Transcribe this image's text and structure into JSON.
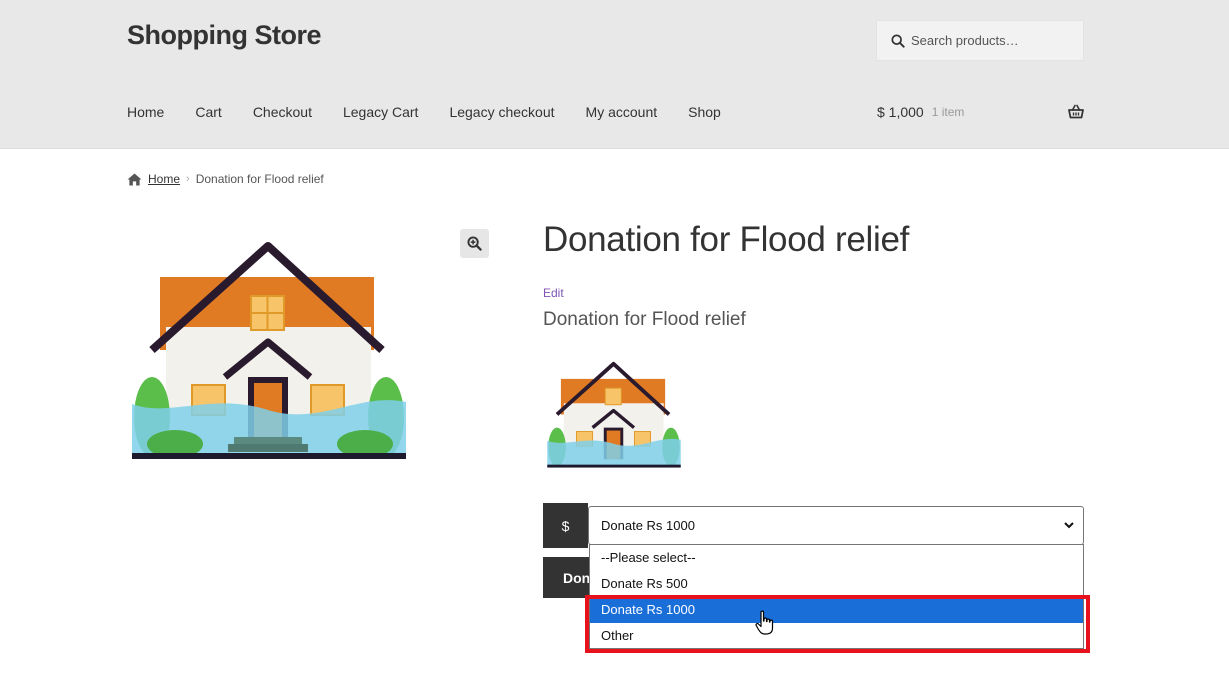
{
  "site": {
    "title": "Shopping Store"
  },
  "search": {
    "placeholder": "Search products…"
  },
  "nav": {
    "items": [
      "Home",
      "Cart",
      "Checkout",
      "Legacy Cart",
      "Legacy checkout",
      "My account",
      "Shop"
    ]
  },
  "cart": {
    "total": "$ 1,000",
    "count": "1 item"
  },
  "breadcrumb": {
    "home": "Home",
    "current": "Donation for Flood relief"
  },
  "product": {
    "title": "Donation for Flood relief",
    "edit_label": "Edit",
    "subtitle": "Donation for Flood relief"
  },
  "donation": {
    "currency_symbol": "$",
    "selected_value": "Donate Rs 1000",
    "button_label": "Donate",
    "options": [
      "--Please select--",
      "Donate Rs 500",
      "Donate Rs 1000",
      "Other"
    ],
    "highlighted_option": "Donate Rs 1000"
  },
  "colors": {
    "header_bg": "#e8e8e8",
    "dark": "#333333",
    "selected_option": "#1a6ed8",
    "highlight_frame": "#e8121c",
    "edit_link": "#7f54b3"
  },
  "icons": {
    "search": "search-icon",
    "basket": "basket-icon",
    "home": "home-icon",
    "zoom": "zoom-in-icon",
    "chevron": "chevron-down-icon",
    "cursor": "hand-pointer-icon"
  }
}
